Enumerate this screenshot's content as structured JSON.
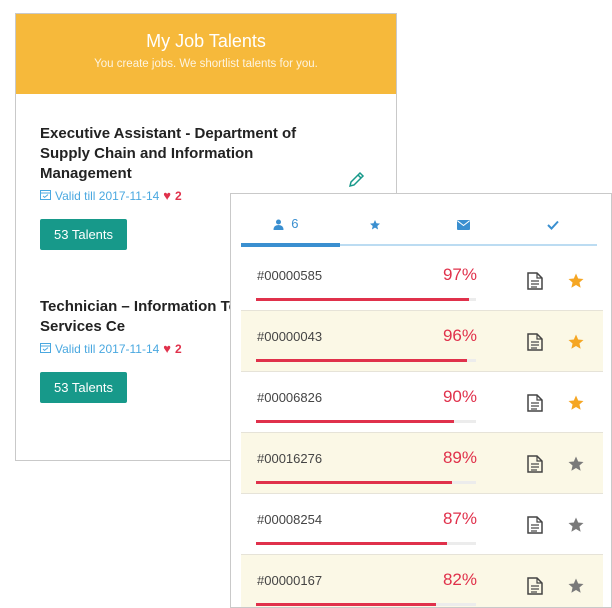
{
  "header": {
    "title": "My Job Talents",
    "subtitle": "You create jobs. We shortlist talents for you."
  },
  "jobs": [
    {
      "title": "Executive Assistant - Department of Supply Chain and Information Management",
      "valid": "Valid till 2017-11-14",
      "likes": "2",
      "button": "53 Talents"
    },
    {
      "title": "Technician – Information Technology Services Ce",
      "valid": "Valid till 2017-11-14",
      "likes": "2",
      "button": "53 Talents"
    }
  ],
  "tabs": {
    "talents_count": "6"
  },
  "colors": {
    "accent": "#f6b93b",
    "teal": "#17998a",
    "blue": "#3a8fd0",
    "red": "#e0314b",
    "star_gold": "#f5a623",
    "star_grey": "#7a7a7a"
  },
  "talents": [
    {
      "id": "#00000585",
      "match": "97%",
      "starred": true
    },
    {
      "id": "#00000043",
      "match": "96%",
      "starred": true
    },
    {
      "id": "#00006826",
      "match": "90%",
      "starred": true
    },
    {
      "id": "#00016276",
      "match": "89%",
      "starred": false
    },
    {
      "id": "#00008254",
      "match": "87%",
      "starred": false
    },
    {
      "id": "#00000167",
      "match": "82%",
      "starred": false
    }
  ]
}
